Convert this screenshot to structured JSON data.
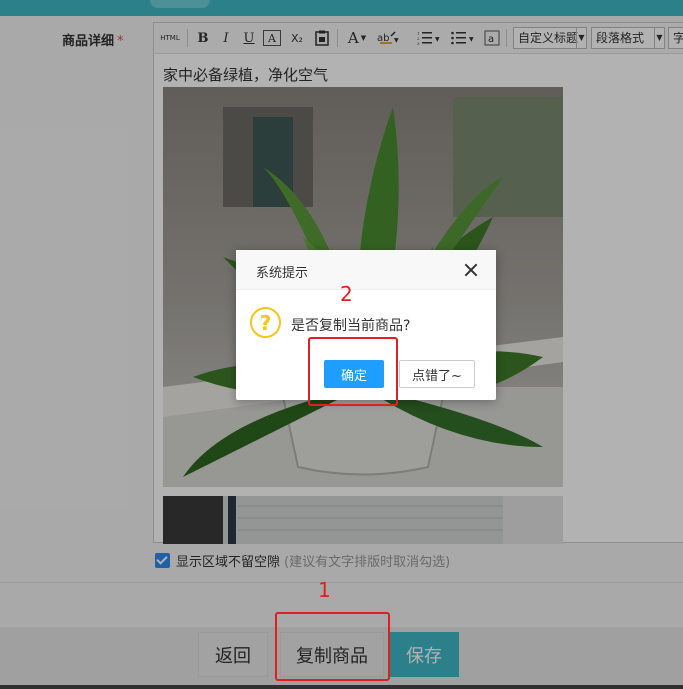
{
  "form": {
    "detail_label": "商品详细",
    "required_mark": "*"
  },
  "editor": {
    "toolbar": {
      "html_label": "HTML",
      "bold": "B",
      "italic": "I",
      "underline": "U",
      "strike": "A",
      "subscript": "X₂",
      "font_color": "A",
      "custom_title_select": "自定义标题",
      "paragraph_select": "段落格式",
      "font_select": "字"
    },
    "content_title": "家中必备绿植，净化空气"
  },
  "checkbox": {
    "label": "显示区域不留空隙",
    "hint": "(建议有文字排版时取消勾选)",
    "checked": true
  },
  "footer": {
    "back_label": "返回",
    "copy_label": "复制商品",
    "save_label": "保存"
  },
  "dialog": {
    "title": "系统提示",
    "message": "是否复制当前商品?",
    "ok_label": "确定",
    "cancel_label": "点错了~"
  },
  "annotations": {
    "step1": "1",
    "step2": "2"
  },
  "colors": {
    "brand": "#3fb8c4",
    "primary_button": "#1e9fff",
    "annotation": "#e02020",
    "warning_icon": "#f5c518"
  }
}
